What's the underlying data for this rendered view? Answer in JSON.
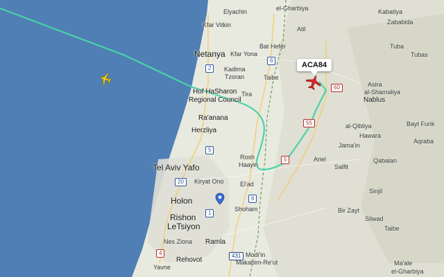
{
  "map": {
    "colors": {
      "sea": "#4f7fb4",
      "land": "#e8eadf",
      "track": "#49d3a8",
      "aircraft_selected": "#e02b2b",
      "aircraft_other": "#f2d01c",
      "pin": "#3b6fd8"
    },
    "flight": {
      "callsign": "ACA84"
    },
    "places": {
      "elyachin": "Elyachin",
      "el_gharbiya": "el-Gharbiya",
      "kfar_vitkin": "Kfar Vitkin",
      "netanya": "Netanya",
      "kfar_yona": "Kfar Yona",
      "bat_hefer": "Bat Hefer",
      "atil": "Atil",
      "kabatiya": "Kabatiya",
      "zababida": "Zababida",
      "tuba": "Tuba",
      "tubas": "Tubas",
      "kadima": "Kadima",
      "tzoran": "Tzoran",
      "taibe": "Taibe",
      "hof_hasharon": "Hof HaSharon",
      "regional_council": "Regional Council",
      "tira": "Tira",
      "asira": "Asira",
      "al_shamaliya": "al-Shamaliya",
      "nablus": "Nablus",
      "raanana": "Ra'anana",
      "al_qibliya": "al-Qibliya",
      "bayt_furik": "Bayt Furik",
      "hawara": "Hawara",
      "herzliya": "Herzliya",
      "jamain": "Jama'in",
      "aqraba": "Aqraba",
      "ariel": "Ariel",
      "salfit": "Salfit",
      "qabalan": "Qabalan",
      "tel_aviv_yafo": "Tel Aviv Yafo",
      "rosh": "Rosh",
      "haayin": "Haayin",
      "kiryat_ono": "Kiryat Ono",
      "elad": "El'ad",
      "sinjil": "Sinjil",
      "holon": "Holon",
      "shoham": "Shoham",
      "rishon": "Rishon",
      "letsiyon": "LeTsiyon",
      "bir_zayt": "Bir Zayt",
      "silwad": "Silwad",
      "taibe_east": "Taibe",
      "nes_ziona": "Nes Ziona",
      "ramla": "Ramla",
      "modiin": "Modi'in",
      "makabim_reut": "Makabim-Re'ut",
      "rehovot": "Rehovot",
      "yavne": "Yavne",
      "maale": "Ma'ale",
      "el_gharbiya_south": "el-Gharbiya"
    },
    "shields": {
      "r6_north": "6",
      "r2": "2",
      "r60": "60",
      "r55": "55",
      "r5": "5",
      "r5_east": "5",
      "r20": "20",
      "r6_south": "6",
      "r1": "1",
      "r4": "4",
      "r431": "431"
    }
  }
}
